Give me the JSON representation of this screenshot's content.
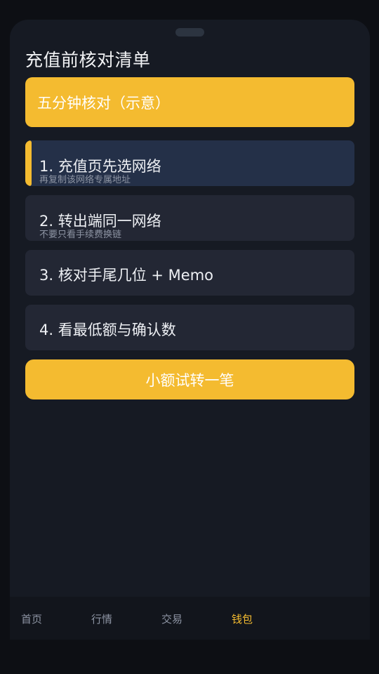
{
  "page": {
    "title": "充值前核对清单"
  },
  "banner": {
    "label": "五分钟核对（示意）"
  },
  "steps": [
    {
      "title": "1. 充值页先选网络",
      "subtitle": "再复制该网络专属地址",
      "active": true
    },
    {
      "title": "2. 转出端同一网络",
      "subtitle": "不要只看手续费换链",
      "active": false
    },
    {
      "title": "3. 核对手尾几位 + Memo",
      "subtitle": "",
      "active": false
    },
    {
      "title": "4. 看最低额与确认数",
      "subtitle": "",
      "active": false
    }
  ],
  "action": {
    "button_label": "小额试转一笔"
  },
  "tabbar": {
    "items": [
      {
        "label": "首页"
      },
      {
        "label": "行情"
      },
      {
        "label": "交易"
      },
      {
        "label": "钱包"
      }
    ],
    "active_index": 3
  },
  "colors": {
    "accent": "#f4bb30",
    "background": "#161a23",
    "card": "#232734",
    "card_active": "#243048"
  }
}
